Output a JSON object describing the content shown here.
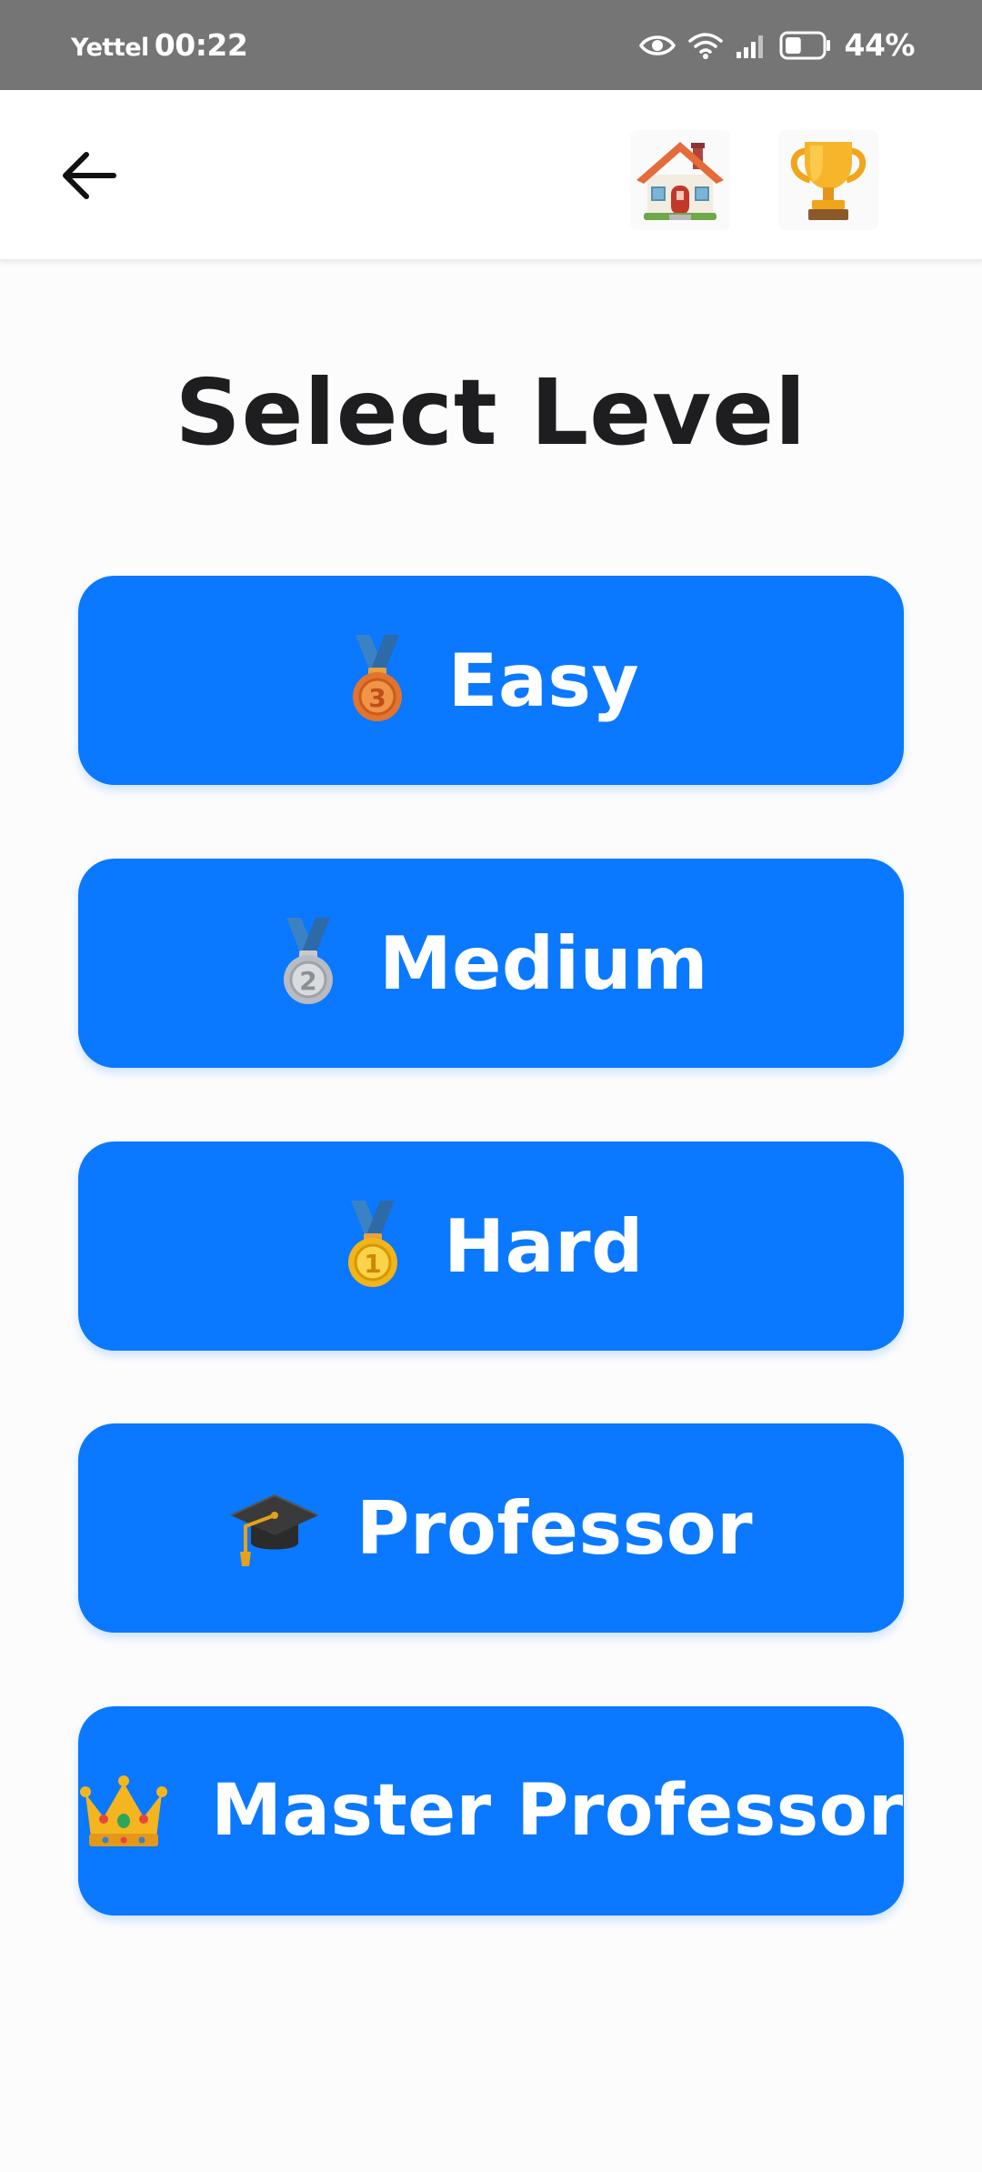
{
  "status_bar": {
    "carrier": "Yettel",
    "time": "00:22",
    "battery_percent": "44%",
    "battery_level": 0.44,
    "icons": [
      "eye-icon",
      "wifi-icon",
      "signal-icon",
      "battery-icon"
    ]
  },
  "app_bar": {
    "back_icon": "arrow-left-icon",
    "home_icon": "house-icon",
    "trophy_icon": "trophy-icon"
  },
  "page": {
    "title": "Select Level"
  },
  "levels": [
    {
      "label": "Easy",
      "icon": "third-place-medal-icon"
    },
    {
      "label": "Medium",
      "icon": "second-place-medal-icon"
    },
    {
      "label": "Hard",
      "icon": "first-place-medal-icon"
    },
    {
      "label": "Professor",
      "icon": "graduation-cap-icon"
    },
    {
      "label": "Master Professor",
      "icon": "crown-icon"
    }
  ],
  "colors": {
    "accent": "#0a78ff",
    "status_bar": "#767576",
    "title": "#1e1e20",
    "background": "#fcfcfd"
  }
}
